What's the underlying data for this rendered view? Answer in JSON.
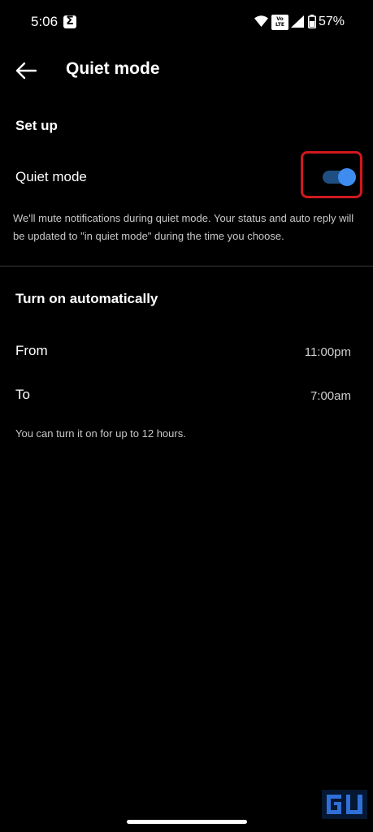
{
  "status_bar": {
    "time": "5:06",
    "volte_top": "Vo",
    "volte_bottom": "LTE",
    "battery": "57%"
  },
  "app_bar": {
    "title": "Quiet mode",
    "back_icon": "arrow-left-icon"
  },
  "setup": {
    "heading": "Set up",
    "quiet_mode_label": "Quiet mode",
    "quiet_mode_enabled": true,
    "description": "We'll mute notifications during quiet mode. Your status and auto reply will be updated to \"in quiet mode\" during the time you choose."
  },
  "auto": {
    "heading": "Turn on automatically",
    "from_label": "From",
    "from_value": "11:00pm",
    "to_label": "To",
    "to_value": "7:00am",
    "hint": "You can turn it on for up to 12 hours."
  },
  "colors": {
    "background": "#000000",
    "toggle_track": "#1f4f82",
    "toggle_knob": "#3e8cf0",
    "highlight": "#d0181e"
  }
}
